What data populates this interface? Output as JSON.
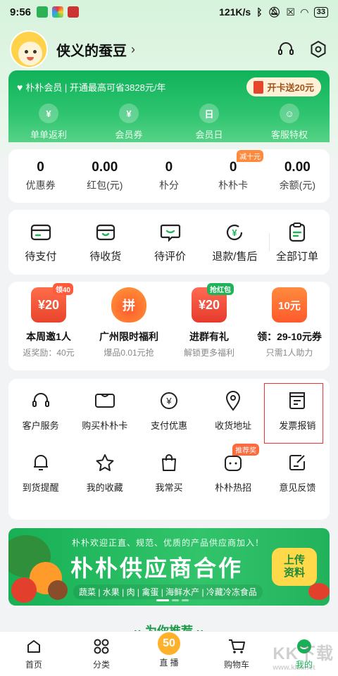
{
  "statusbar": {
    "time": "9:56",
    "network_speed": "121K/s",
    "battery": "33"
  },
  "user": {
    "name": "侠义的蚕豆",
    "chevron": "›"
  },
  "member": {
    "tagline": "朴朴会员 | 开通最高可省3828元/年",
    "cta": "开卡送20元",
    "perks": [
      {
        "label": "单单返利",
        "icon_text": "¥"
      },
      {
        "label": "会员券",
        "icon_text": "¥"
      },
      {
        "label": "会员日",
        "icon_text": "日"
      },
      {
        "label": "客服特权",
        "icon_text": "☺"
      }
    ]
  },
  "stats": [
    {
      "value": "0",
      "label": "优惠券"
    },
    {
      "value": "0.00",
      "label": "红包(元)"
    },
    {
      "value": "0",
      "label": "朴分"
    },
    {
      "value": "0",
      "label": "朴朴卡",
      "badge": "减十元"
    },
    {
      "value": "0.00",
      "label": "余额(元)"
    }
  ],
  "orders": [
    {
      "label": "待支付"
    },
    {
      "label": "待收货"
    },
    {
      "label": "待评价"
    },
    {
      "label": "退款/售后"
    },
    {
      "label": "全部订单"
    }
  ],
  "promos": [
    {
      "title": "本周邀1人",
      "sub": "返奖励：40元",
      "tag": "领40",
      "icon_text": "¥20"
    },
    {
      "title": "广州限时福利",
      "sub": "爆品0.01元抢",
      "icon_text": "拼"
    },
    {
      "title": "进群有礼",
      "sub": "解锁更多福利",
      "tag": "抢红包",
      "icon_text": "¥20"
    },
    {
      "title": "领：29-10元券",
      "sub": "只需1人助力",
      "icon_text": "10元"
    }
  ],
  "services_row1": [
    {
      "label": "客户服务"
    },
    {
      "label": "购买朴朴卡"
    },
    {
      "label": "支付优惠"
    },
    {
      "label": "收货地址"
    },
    {
      "label": "发票报销"
    }
  ],
  "services_row2": [
    {
      "label": "到货提醒"
    },
    {
      "label": "我的收藏"
    },
    {
      "label": "我常买"
    },
    {
      "label": "朴朴热招",
      "tag": "推荐奖"
    },
    {
      "label": "意见反馈"
    }
  ],
  "banner": {
    "subtitle": "朴朴欢迎正直、规范、优质的产品供应商加入！",
    "title": "朴朴供应商合作",
    "categories": "蔬菜 | 水果 | 肉 | 禽蛋 | 海鲜水产 | 冷藏冷冻食品",
    "cta_line1": "上传",
    "cta_line2": "资料"
  },
  "recommend_title": "·· 为你推荐 ··",
  "tabbar": [
    {
      "label": "首页"
    },
    {
      "label": "分类"
    },
    {
      "label": "直 播",
      "badge": "50"
    },
    {
      "label": "购物车"
    },
    {
      "label": "我的"
    }
  ],
  "watermark": {
    "main": "KK下载",
    "sub": "www.kkx.net"
  },
  "colors": {
    "brand_green": "#18b055",
    "accent_orange": "#ff8a3d",
    "highlight_red": "#e33333"
  }
}
